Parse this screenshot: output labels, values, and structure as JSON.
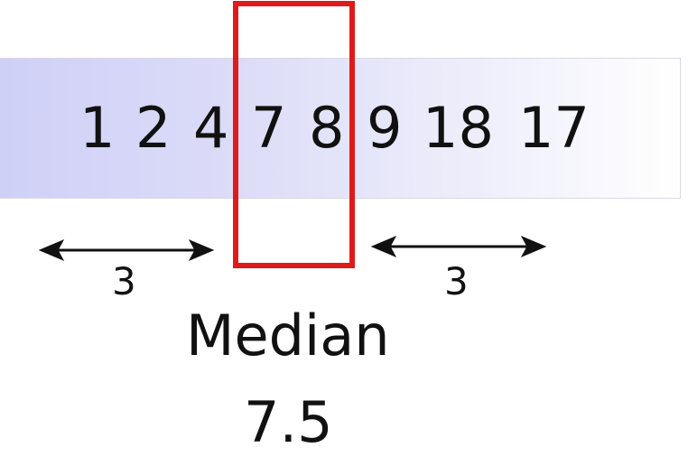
{
  "numbers": [
    "1",
    "2",
    "4",
    "7",
    "8",
    "9",
    "18",
    "17"
  ],
  "left_count": "3",
  "right_count": "3",
  "median_label": "Median",
  "median_value": "7.5",
  "colors": {
    "band_start": "#cfd0f7",
    "band_end": "#ffffff",
    "highlight": "#e01a1a",
    "text": "#111111"
  }
}
